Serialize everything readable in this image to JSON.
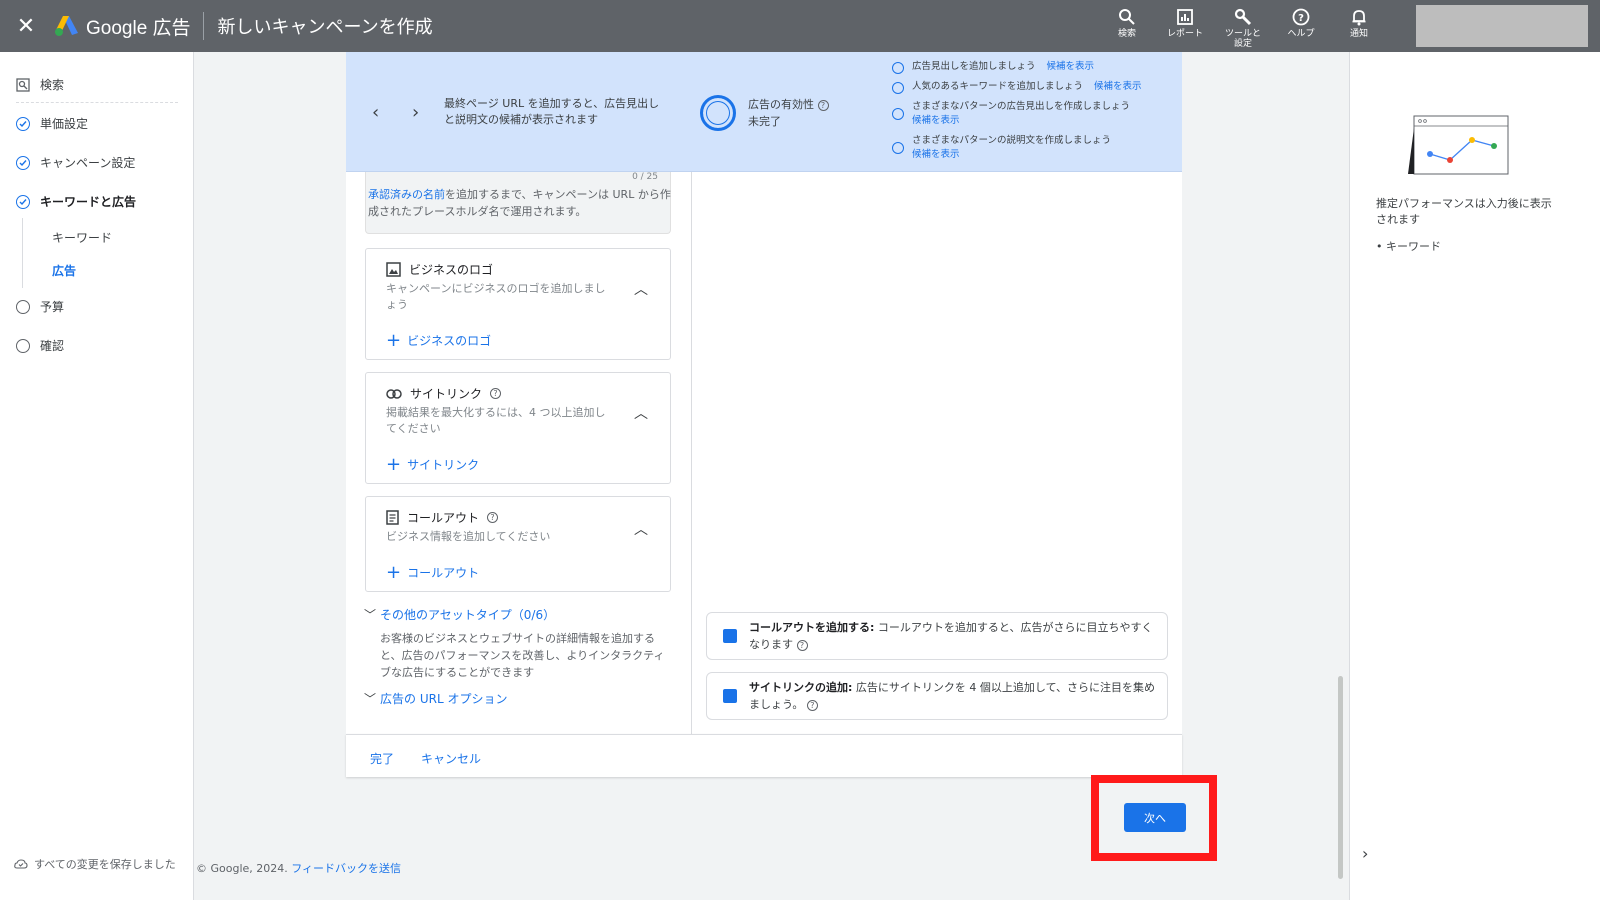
{
  "header": {
    "brand": "Google 広告",
    "title": "新しいキャンペーンを作成",
    "tools": [
      {
        "label": "検索",
        "icon": "search-icon"
      },
      {
        "label": "レポート",
        "icon": "report-icon"
      },
      {
        "label": "ツールと\n設定",
        "icon": "wrench-icon"
      },
      {
        "label": "ヘルプ",
        "icon": "help-icon"
      },
      {
        "label": "通知",
        "icon": "bell-icon"
      }
    ]
  },
  "nav": {
    "search": "検索",
    "items": [
      {
        "label": "単価設定",
        "state": "done"
      },
      {
        "label": "キャンペーン設定",
        "state": "done"
      },
      {
        "label": "キーワードと広告",
        "state": "done"
      },
      {
        "label": "予算",
        "state": "todo"
      },
      {
        "label": "確認",
        "state": "todo"
      }
    ],
    "sub_items": [
      "キーワード",
      "広告"
    ],
    "saved": "すべての変更を保存しました"
  },
  "banner": {
    "message": "最終ページ URL を追加すると、広告見出しと説明文の候補が表示されます",
    "effectiveness_title": "広告の有効性",
    "effectiveness_status": "未完了",
    "tips": [
      {
        "text": "広告見出しを追加しましょう",
        "link": "候補を表示"
      },
      {
        "text": "人気のあるキーワードを追加しましょう",
        "link": "候補を表示"
      },
      {
        "text": "さまざまなパターンの広告見出しを作成しましょう",
        "link": "候補を表示"
      },
      {
        "text": "さまざまなパターンの説明文を作成しましょう",
        "link": "候補を表示"
      }
    ]
  },
  "form": {
    "name_counter": "0 / 25",
    "name_note_link": "承認済みの名前",
    "name_note_rest": "を追加するまで、キャンペーンは URL から作成されたプレースホルダ名で運用されます。",
    "logo": {
      "title": "ビジネスのロゴ",
      "desc": "キャンペーンにビジネスのロゴを追加しましょう",
      "add": "ビジネスのロゴ"
    },
    "sitelink": {
      "title": "サイトリンク",
      "desc": "掲載結果を最大化するには、4 つ以上追加してください",
      "add": "サイトリンク"
    },
    "callout": {
      "title": "コールアウト",
      "desc": "ビジネス情報を追加してください",
      "add": "コールアウト"
    },
    "other_assets": "その他のアセットタイプ（0/6）",
    "other_assets_desc": "お客様のビジネスとウェブサイトの詳細情報を追加すると、広告のパフォーマンスを改善し、よりインタラクティブな広告にすることができます",
    "url_options": "広告の URL オプション"
  },
  "recommendations": [
    {
      "bold": "コールアウトを追加する:",
      "text": " コールアウトを追加すると、広告がさらに目立ちやすくなります"
    },
    {
      "bold": "サイトリンクの追加:",
      "text": " 広告にサイトリンクを 4 個以上追加して、さらに注目を集めましょう。"
    }
  ],
  "footer": {
    "done": "完了",
    "cancel": "キャンセル",
    "next": "次へ"
  },
  "copyright": "© Google, 2024.",
  "feedback": "フィードバックを送信",
  "right_panel": {
    "perf_note": "推定パフォーマンスは入力後に表示されます",
    "bullet": "キーワード"
  },
  "colors": {
    "topbar": "#5f6368",
    "accent": "#1a73e8",
    "banner": "#d2e3fc",
    "highlight": "#ff1a1a"
  }
}
